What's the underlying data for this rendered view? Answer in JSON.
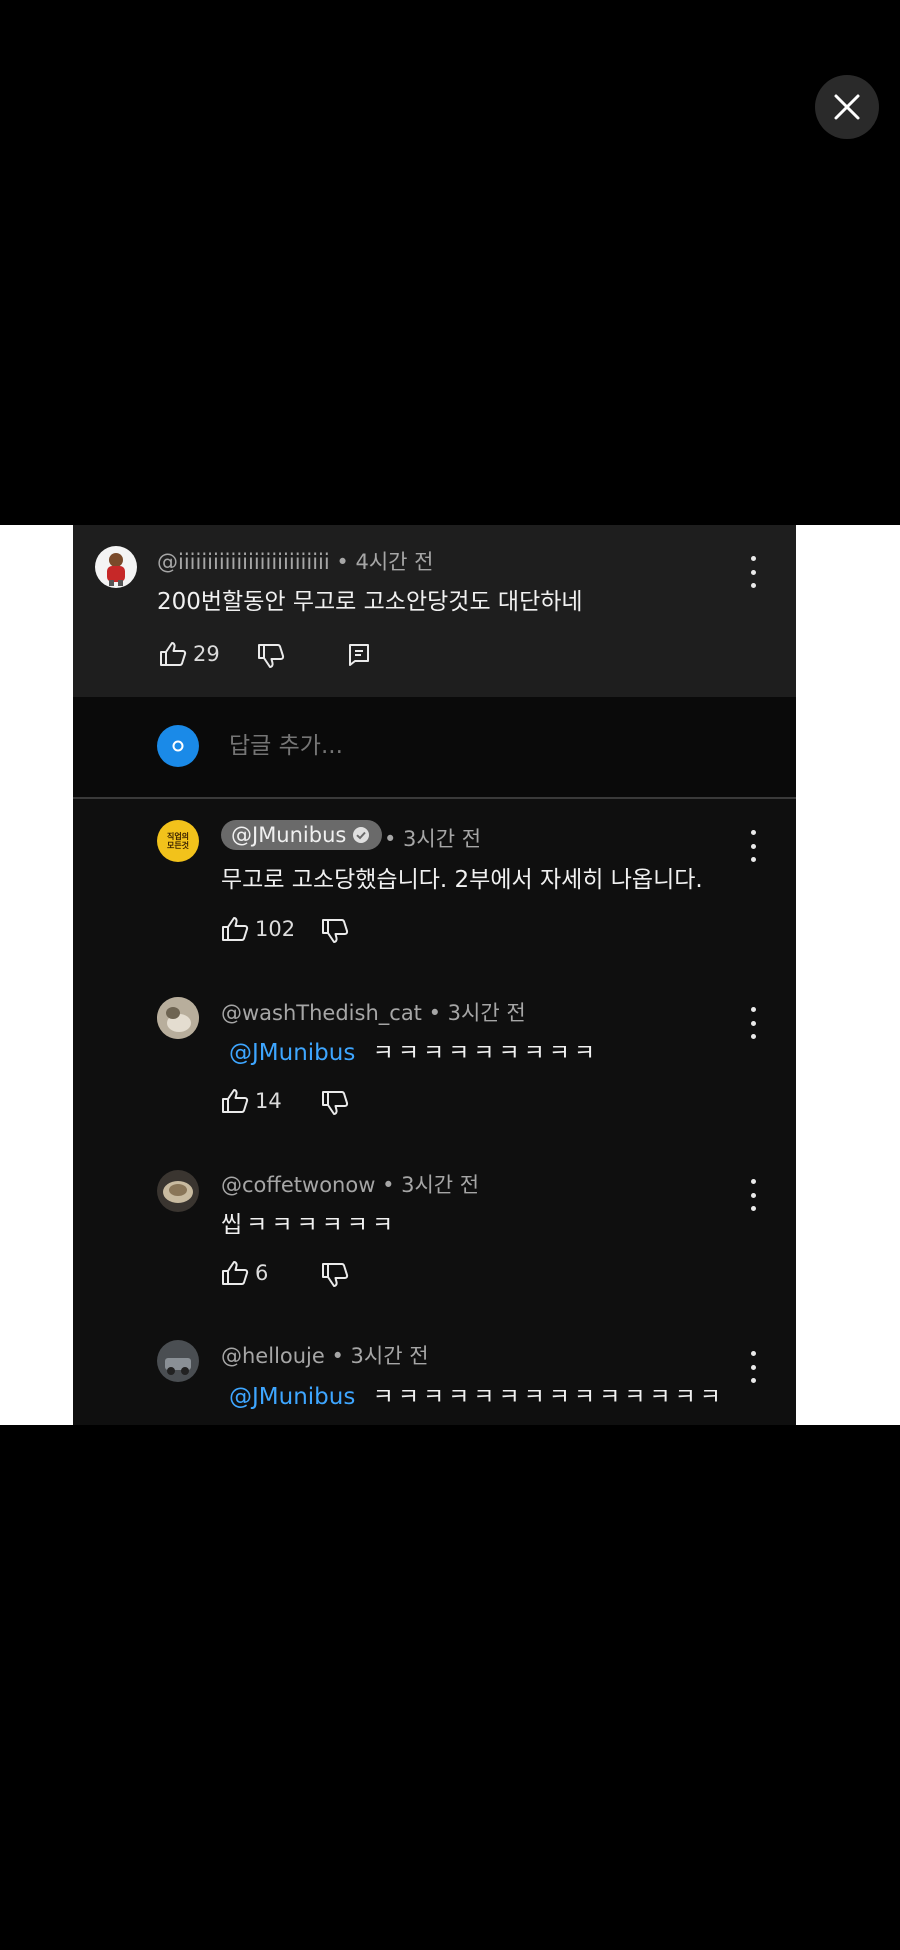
{
  "close_label": "",
  "parent_comment": {
    "handle": "@iiiiiiiiiiiiiiiiiiiiiiiiii",
    "time": "• 4시간 전",
    "text": "200번할동안 무고로 고소안당것도 대단하네",
    "likes": "29"
  },
  "add_reply": {
    "placeholder": "답글 추가..."
  },
  "replies": [
    {
      "handle": "@JMunibus",
      "verified": true,
      "time": "• 3시간 전",
      "text": "무고로 고소당했습니다. 2부에서 자세히 나옵니다.",
      "likes": "102",
      "avatar_text": "직업의 모든것"
    },
    {
      "handle": "@washThedish_cat",
      "time": "• 3시간 전",
      "mention": "@JMunibus",
      "text": "ㅋㅋㅋㅋㅋㅋㅋㅋㅋ",
      "likes": "14"
    },
    {
      "handle": "@coffetwonow",
      "time": "• 3시간 전",
      "text": "씹ㅋㅋㅋㅋㅋㅋ",
      "likes": "6"
    },
    {
      "handle": "@hellouje",
      "time": "• 3시간 전",
      "mention": "@JMunibus",
      "text": "ㅋㅋㅋㅋㅋㅋㅋㅋㅋㅋㅋㅋㅋㅋ"
    }
  ],
  "colors": {
    "background": "#000000",
    "panel": "#0f0f0f",
    "parent_highlight": "#1e1e1e",
    "mention": "#3ea6ff",
    "reply_avatar": "#1a8ae8"
  }
}
